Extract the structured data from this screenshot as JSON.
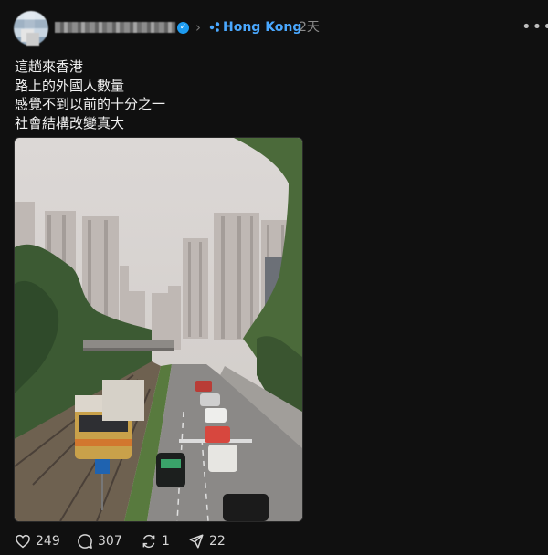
{
  "header": {
    "topic": "Hong Kong",
    "time_ago": "2天",
    "more_label": "•••"
  },
  "post": {
    "lines": [
      "這趟來香港",
      "路上的外國人數量",
      "感覺不到以前的十分之一",
      "社會結構改變真大"
    ]
  },
  "actions": {
    "likes": "249",
    "replies": "307",
    "reposts": "1",
    "shares": "22"
  },
  "colors": {
    "background": "#101010",
    "topic": "#4aa8ff",
    "verified": "#1d9bf0",
    "muted": "#8a8a8a"
  },
  "icons": [
    "verified-badge-icon",
    "chevron-right-icon",
    "topic-icon",
    "more-icon",
    "heart-icon",
    "comment-icon",
    "repost-icon",
    "share-icon"
  ]
}
